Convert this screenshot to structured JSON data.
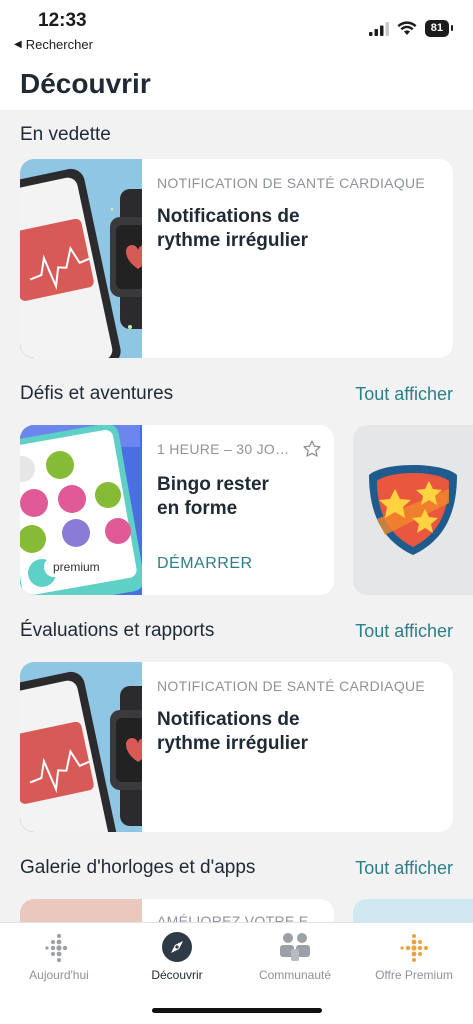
{
  "status": {
    "time": "12:33",
    "back_label": "Rechercher",
    "battery": "81"
  },
  "header": {
    "title": "Découvrir"
  },
  "featured": {
    "title": "En vedette",
    "card": {
      "eyebrow": "NOTIFICATION DE SANTÉ CARDIAQUE",
      "title_line1": "Notifications de",
      "title_line2": "rythme irrégulier"
    }
  },
  "challenges": {
    "title": "Défis et aventures",
    "see_all": "Tout afficher",
    "card": {
      "eyebrow": "1 HEURE – 30 JO…",
      "title_line1": "Bingo rester",
      "title_line2": "en forme",
      "cta": "DÉMARRER",
      "badge": "premium"
    }
  },
  "assessments": {
    "title": "Évaluations et rapports",
    "see_all": "Tout afficher",
    "card": {
      "eyebrow": "NOTIFICATION DE SANTÉ CARDIAQUE",
      "title_line1": "Notifications de",
      "title_line2": "rythme irrégulier"
    }
  },
  "gallery": {
    "title": "Galerie d'horloges et d'apps",
    "see_all": "Tout afficher",
    "card_eyebrow": "AMÉLIOREZ VOTRE E"
  },
  "tabs": [
    {
      "label": "Aujourd'hui",
      "icon": "fitbit-dots-icon",
      "active": false
    },
    {
      "label": "Découvrir",
      "icon": "compass-icon",
      "active": true
    },
    {
      "label": "Communauté",
      "icon": "community-icon",
      "active": false
    },
    {
      "label": "Offre Premium",
      "icon": "premium-dots-icon",
      "active": false
    }
  ],
  "colors": {
    "accent": "#2c7f86",
    "heart_red": "#d9534f",
    "card_bg_blue": "#7fbfe0"
  }
}
